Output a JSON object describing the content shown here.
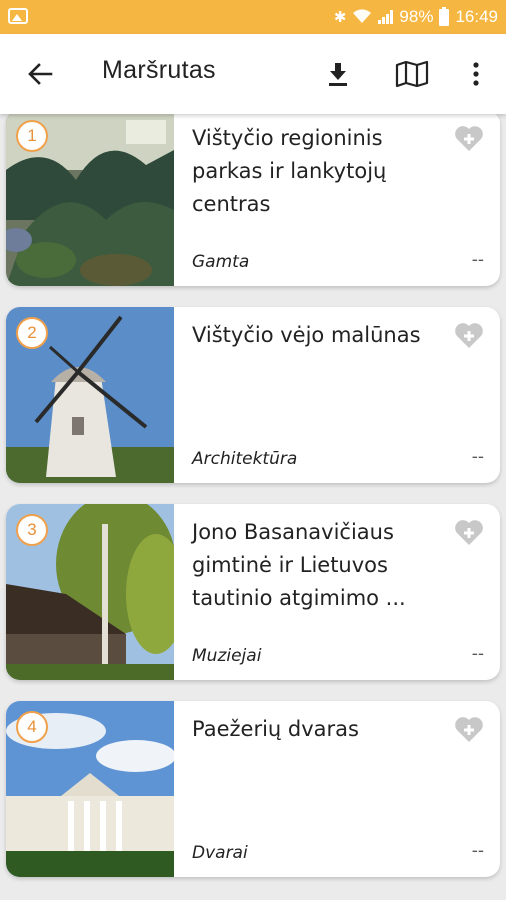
{
  "status": {
    "battery": "98%",
    "time": "16:49"
  },
  "toolbar": {
    "title": "Maršrutas",
    "icons": [
      "arrow-left-icon",
      "download-icon",
      "map-icon",
      "more-vert-icon"
    ]
  },
  "colors": {
    "status_bar": "#f6b742",
    "badge_accent": "#e8903a",
    "fav_icon": "#c8c8c8"
  },
  "items": [
    {
      "number": "1",
      "title": "Vištyčio regioninis parkas ir lankytojų centras",
      "category": "Gamta",
      "distance": "--"
    },
    {
      "number": "2",
      "title": "Vištyčio vėjo malūnas",
      "category": "Architektūra",
      "distance": "--"
    },
    {
      "number": "3",
      "title": "Jono Basanavičiaus gimtinė ir Lietuvos tautinio atgimimo ...",
      "category": "Muziejai",
      "distance": "--"
    },
    {
      "number": "4",
      "title": "Paežerių dvaras",
      "category": "Dvarai",
      "distance": "--"
    }
  ]
}
